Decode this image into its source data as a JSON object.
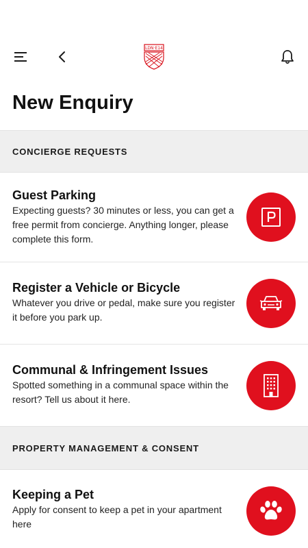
{
  "header": {
    "menu_icon": "menu-icon",
    "back_icon": "chevron-left-icon",
    "logo_text": "LDN·E14",
    "bell_icon": "bell-icon",
    "accent_color": "#e0101e"
  },
  "page": {
    "title": "New Enquiry"
  },
  "sections": [
    {
      "header": "CONCIERGE REQUESTS",
      "items": [
        {
          "title": "Guest Parking",
          "description": "Expecting guests? 30 minutes or less, you can get a free permit from concierge. Anything longer, please complete this form.",
          "icon": "parking-icon"
        },
        {
          "title": "Register a Vehicle or Bicycle",
          "description": "Whatever you drive or pedal, make sure you register it before you park up.",
          "icon": "car-icon"
        },
        {
          "title": "Communal & Infringement Issues",
          "description": "Spotted something in a communal space within the resort? Tell us about it here.",
          "icon": "building-icon"
        }
      ]
    },
    {
      "header": "PROPERTY MANAGEMENT & CONSENT",
      "items": [
        {
          "title": "Keeping a Pet",
          "description": "Apply for consent to keep a pet in your apartment here",
          "icon": "paw-icon"
        }
      ]
    }
  ]
}
